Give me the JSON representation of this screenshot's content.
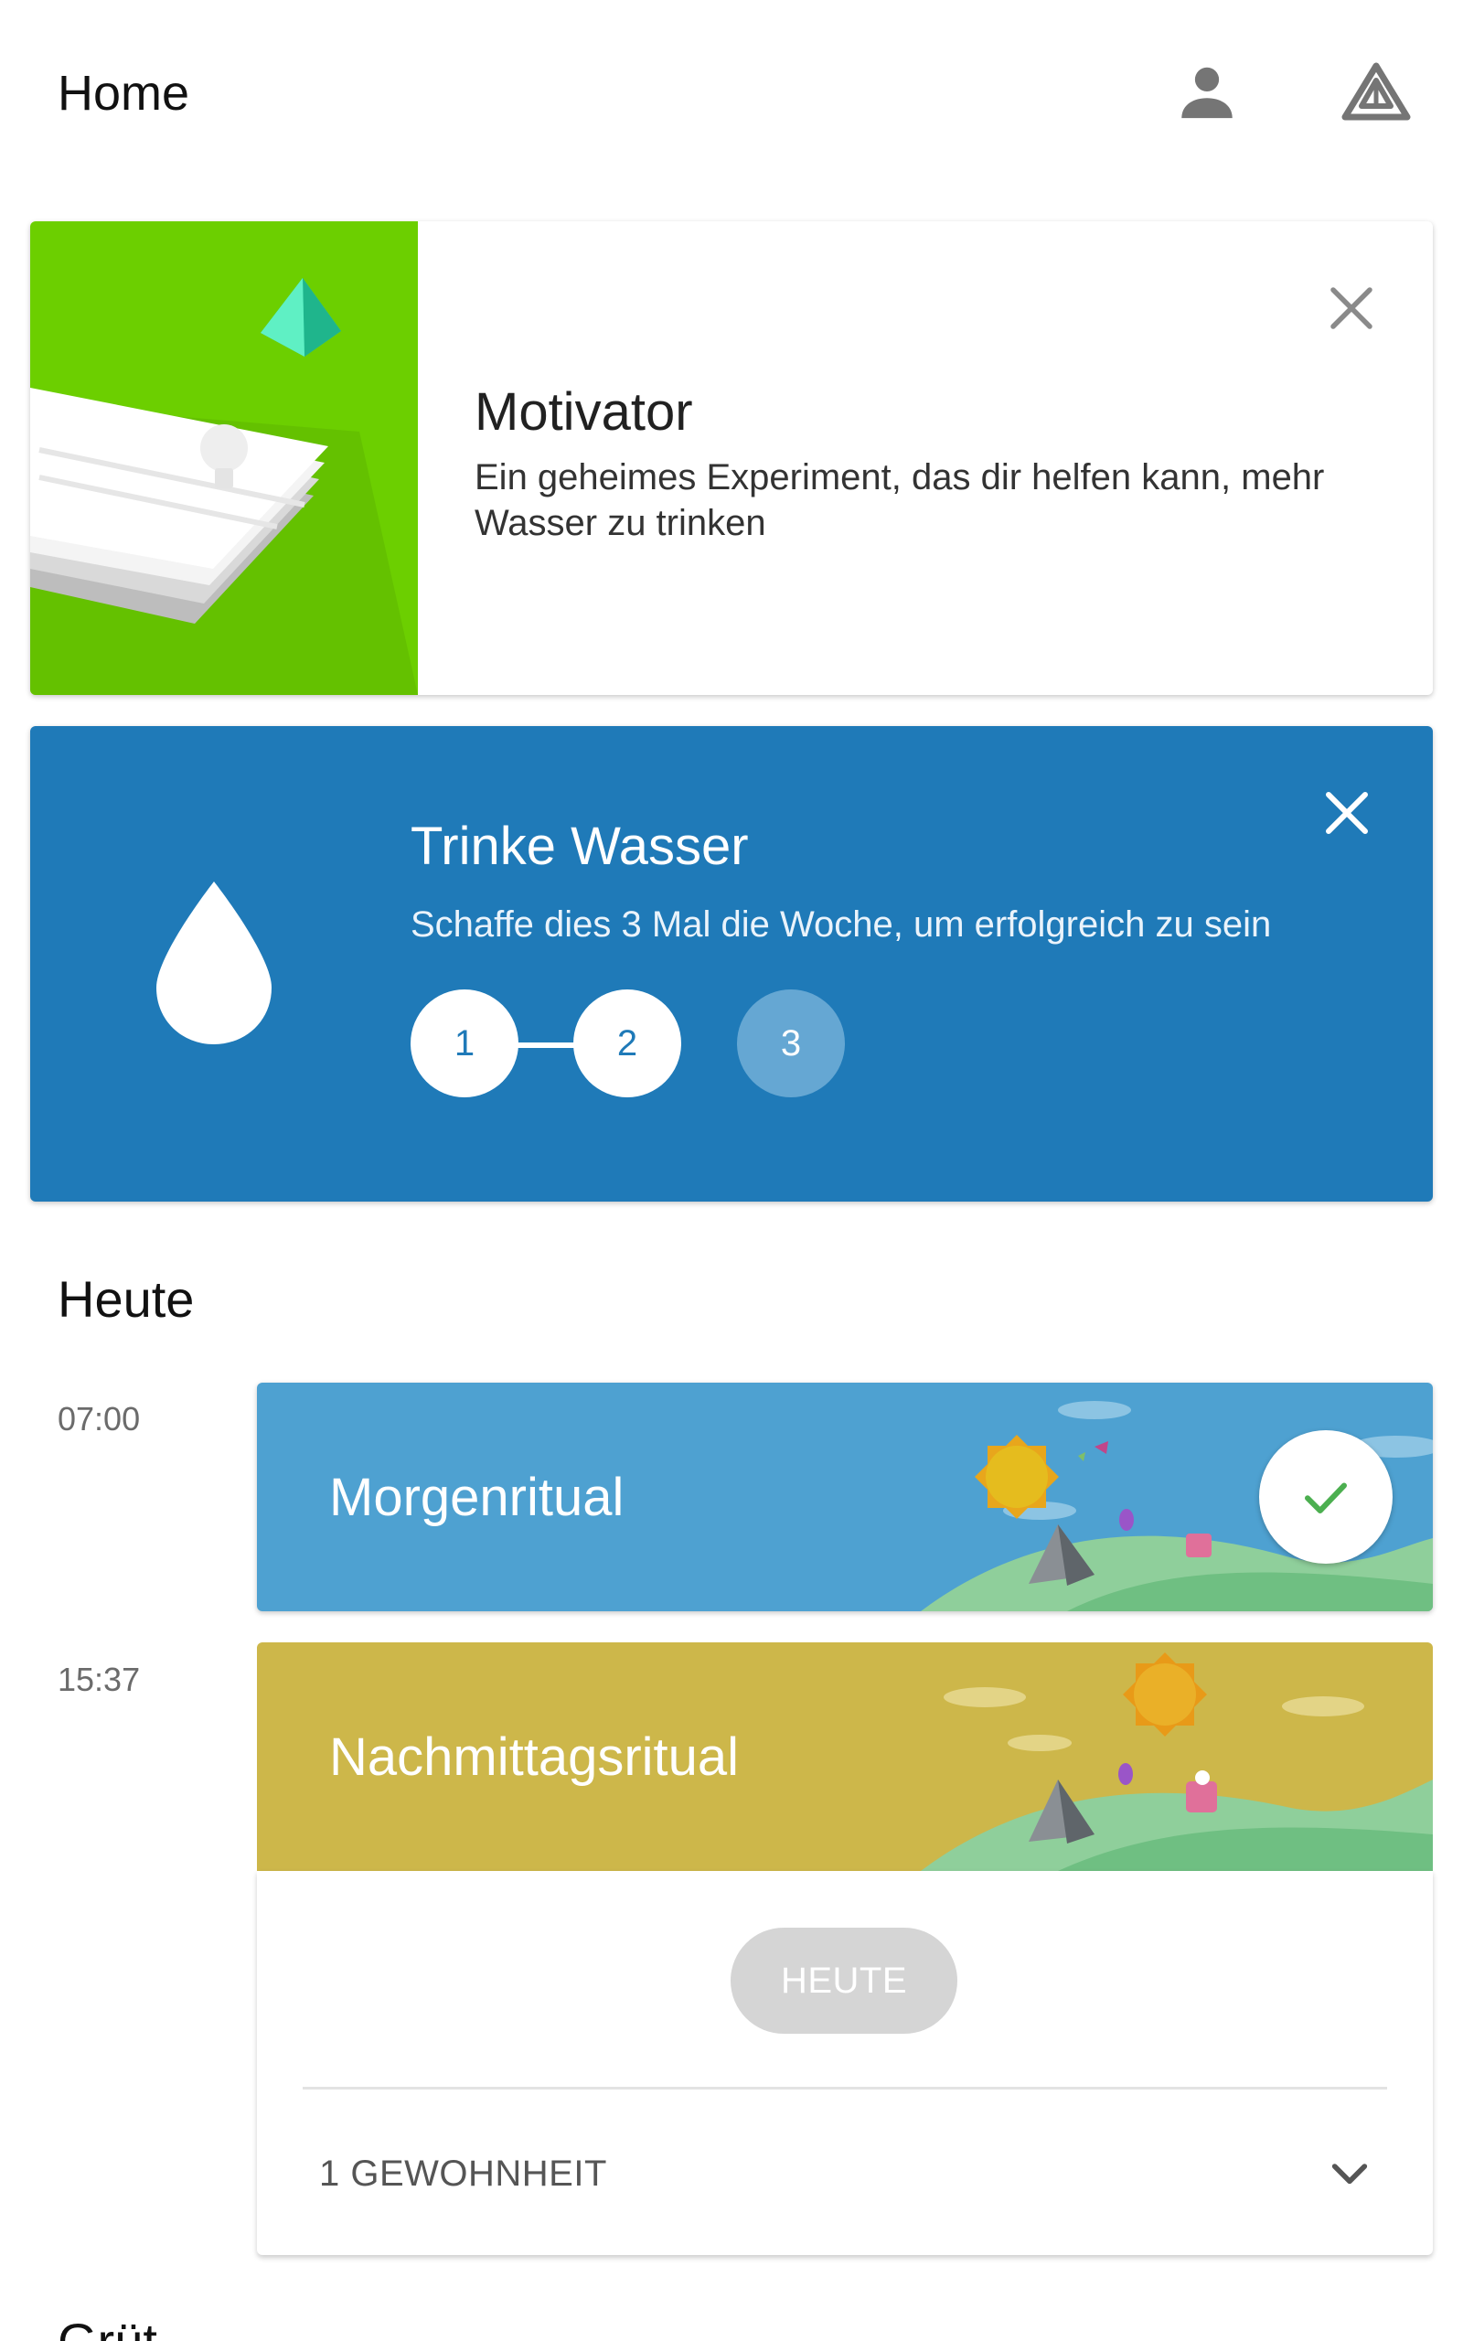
{
  "appbar": {
    "title": "Home",
    "icons": [
      "person-icon",
      "fabulous-triangle-icon"
    ]
  },
  "motivator": {
    "title": "Motivator",
    "description": "Ein geheimes Experiment, das dir helfen kann, mehr Wasser zu trinken",
    "art_color": "#6ccf00"
  },
  "goal": {
    "title": "Trinke Wasser",
    "description": "Schaffe dies 3 Mal die Woche, um erfolgreich zu sein",
    "color": "#1f7ab8",
    "steps": [
      {
        "label": "1",
        "done": true
      },
      {
        "label": "2",
        "done": true
      },
      {
        "label": "3",
        "done": false
      }
    ]
  },
  "today": {
    "title": "Heute",
    "rituals": [
      {
        "time": "07:00",
        "name": "Morgenritual",
        "color": "#4ea1d1",
        "completed": true
      },
      {
        "time": "15:37",
        "name": "Nachmittagsritual",
        "color": "#cdb74a",
        "completed": false
      }
    ],
    "panel": {
      "today_button": "HEUTE",
      "habit_count": "1 GEWOHNHEIT"
    }
  },
  "next_section_title": "Grüt"
}
